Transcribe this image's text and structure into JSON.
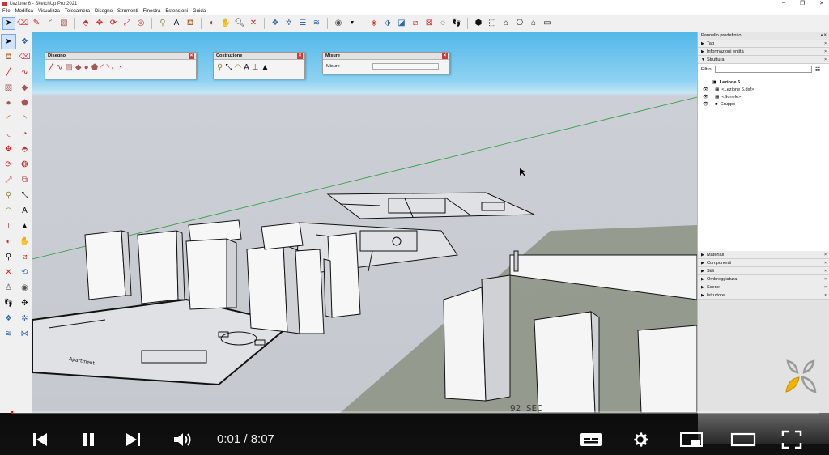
{
  "window": {
    "title": "Lezione 6 - SketchUp Pro 2021",
    "controls": {
      "minimize": "–",
      "maximize": "❐",
      "close": "✕"
    }
  },
  "menu": [
    "File",
    "Modifica",
    "Visualizza",
    "Telecamera",
    "Disegno",
    "Strumenti",
    "Finestra",
    "Estensioni",
    "Guida"
  ],
  "toolbar_icons": [
    "select-arrow-icon",
    "eraser-icon",
    "pencil-icon",
    "arc-icon",
    "rectangle-icon",
    "pushpull-icon",
    "move-icon",
    "rotate-icon",
    "scale-icon",
    "offset-icon",
    "tape-icon",
    "text-icon",
    "paint-icon",
    "orbit-icon",
    "pan-icon",
    "zoom-icon",
    "zoom-extents-icon",
    "warehouse-icon",
    "extension-icon",
    "user-icon",
    "section-icon",
    "views-icon"
  ],
  "floating_panels": {
    "disegno": {
      "title": "Disegno"
    },
    "costruzione": {
      "title": "Costruzione"
    },
    "misure": {
      "title": "Misure",
      "label": "Misure",
      "value": ""
    }
  },
  "right_panel": {
    "header": "Pannello predefinito",
    "trays_top": [
      {
        "label": "Tag",
        "expanded": false
      },
      {
        "label": "Informazioni entità",
        "expanded": false
      },
      {
        "label": "Struttura",
        "expanded": true
      }
    ],
    "filter_label": "Filtro:",
    "outline": {
      "root": "Lezione 6",
      "children": [
        "<Lezione 6.dxf>",
        "<Sunele>",
        "Gruppo"
      ]
    },
    "trays_bottom": [
      {
        "label": "Materiali"
      },
      {
        "label": "Componenti"
      },
      {
        "label": "Stili"
      },
      {
        "label": "Ombreggiatura"
      },
      {
        "label": "Scene"
      },
      {
        "label": "Istruttore"
      }
    ]
  },
  "viewport": {
    "plan_label": "Apartment",
    "floor_text": "92 SEC"
  },
  "player": {
    "current_time": "0:01",
    "duration": "8:07",
    "time_display": "0:01 / 8:07",
    "progress": 0.002
  },
  "colors": {
    "accent": "#ff0000",
    "sky": "#52b8e8",
    "ground": "#c5c9cf"
  }
}
